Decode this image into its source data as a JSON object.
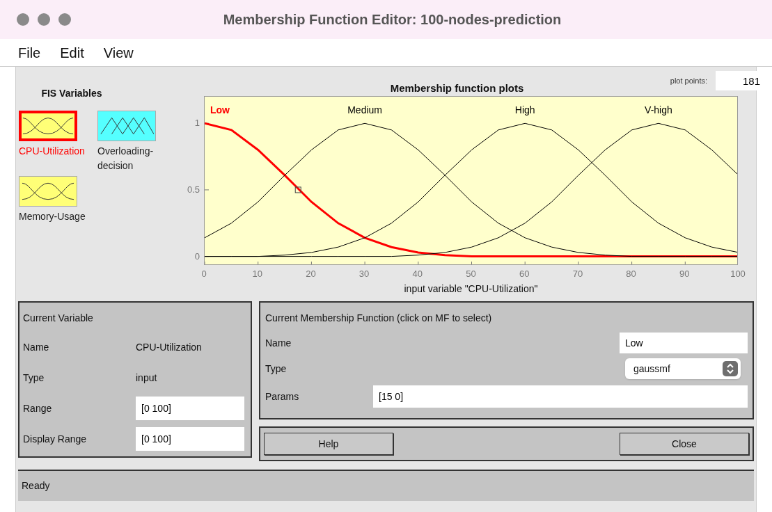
{
  "window": {
    "title": "Membership Function Editor: 100-nodes-prediction"
  },
  "menu": [
    "File",
    "Edit",
    "View"
  ],
  "fis_variables": {
    "title": "FIS Variables",
    "items": [
      {
        "name": "CPU-Utilization",
        "kind": "input",
        "selected": true
      },
      {
        "name": "Overloading-decision",
        "kind": "output",
        "selected": false
      },
      {
        "name": "Memory-Usage",
        "kind": "input",
        "selected": false
      }
    ]
  },
  "plot_points": {
    "label": "plot points:",
    "value": "181"
  },
  "plot": {
    "chart_data": {
      "type": "line",
      "title": "Membership function plots",
      "xlabel": "input variable \"CPU-Utilization\"",
      "x": [
        0,
        5,
        10,
        15,
        20,
        25,
        30,
        35,
        40,
        45,
        50,
        55,
        60,
        65,
        70,
        75,
        80,
        85,
        90,
        95,
        100
      ],
      "xlim": [
        0,
        100
      ],
      "ylim": [
        -0.07,
        1.2
      ],
      "xticks": [
        0,
        10,
        20,
        30,
        40,
        50,
        60,
        70,
        80,
        90,
        100
      ],
      "yticks": [
        0,
        0.5,
        1
      ],
      "series": [
        {
          "name": "Low",
          "color": "#ff0000",
          "values": [
            1,
            0.95,
            0.8,
            0.61,
            0.41,
            0.25,
            0.14,
            0.07,
            0.03,
            0.01,
            0,
            0,
            0,
            0,
            0,
            0,
            0,
            0,
            0,
            0,
            0
          ]
        },
        {
          "name": "Medium",
          "color": "#000000",
          "values": [
            0.14,
            0.25,
            0.41,
            0.61,
            0.8,
            0.95,
            1,
            0.95,
            0.8,
            0.61,
            0.41,
            0.25,
            0.14,
            0.07,
            0.03,
            0.01,
            0,
            0,
            0,
            0,
            0
          ]
        },
        {
          "name": "High",
          "color": "#000000",
          "values": [
            0,
            0,
            0,
            0.01,
            0.03,
            0.07,
            0.14,
            0.25,
            0.41,
            0.61,
            0.8,
            0.95,
            1,
            0.95,
            0.8,
            0.61,
            0.41,
            0.25,
            0.14,
            0.07,
            0.03
          ]
        },
        {
          "name": "V-high",
          "color": "#000000",
          "values": [
            0,
            0,
            0,
            0,
            0,
            0,
            0,
            0,
            0.01,
            0.03,
            0.07,
            0.14,
            0.25,
            0.41,
            0.61,
            0.8,
            0.95,
            1,
            0.95,
            0.8,
            0.61
          ]
        }
      ]
    }
  },
  "current_variable": {
    "title": "Current Variable",
    "rows": [
      {
        "label": "Name",
        "value": "CPU-Utilization",
        "kind": "text"
      },
      {
        "label": "Type",
        "value": "input",
        "kind": "text"
      },
      {
        "label": "Range",
        "value": "[0 100]",
        "kind": "field"
      },
      {
        "label": "Display Range",
        "value": "[0 100]",
        "kind": "field"
      }
    ]
  },
  "current_mf": {
    "title": "Current Membership Function (click on MF to select)",
    "name_label": "Name",
    "name_value": "Low",
    "type_label": "Type",
    "type_value": "gaussmf",
    "params_label": "Params",
    "params_value": "[15 0]"
  },
  "buttons": [
    "Help",
    "Close"
  ],
  "status_bar": "Ready"
}
